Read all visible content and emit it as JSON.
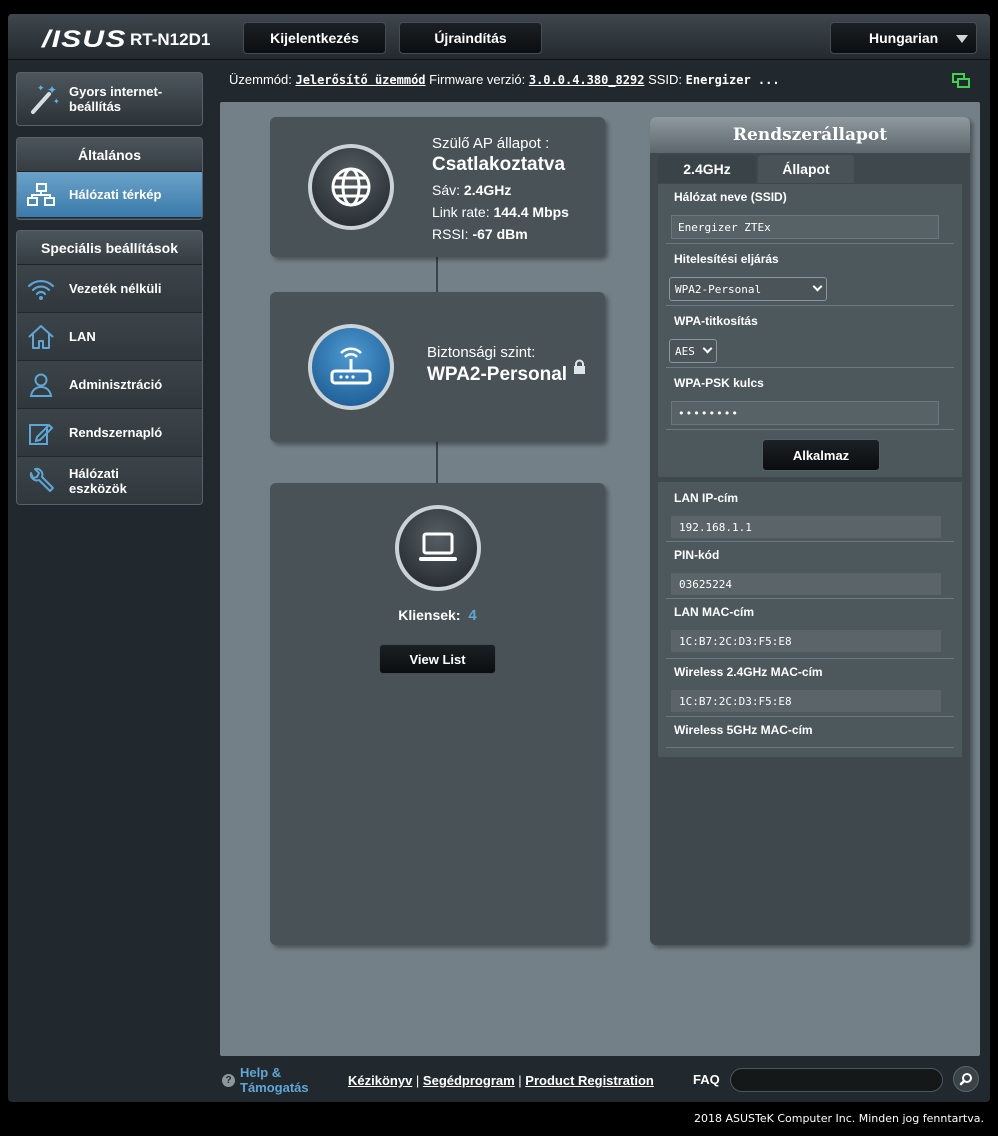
{
  "header": {
    "brand": "/ISUS",
    "model": "RT-N12D1",
    "logout": "Kijelentkezés",
    "reboot": "Újraindítás",
    "language": "Hungarian"
  },
  "sidebar": {
    "quick_setup": "Gyors internet-beállítás",
    "general_head": "Általános",
    "network_map": "Hálózati térkép",
    "advanced_head": "Speciális beállítások",
    "items": [
      {
        "label": "Vezeték nélküli"
      },
      {
        "label": "LAN"
      },
      {
        "label": "Adminisztráció"
      },
      {
        "label": "Rendszernapló"
      },
      {
        "label": "Hálózati eszközök"
      }
    ]
  },
  "status": {
    "mode_label": "Üzemmód:",
    "mode_value": "Jelerősítő üzemmód",
    "fw_label": "Firmware verzió:",
    "fw_value": "3.0.0.4.380_8292",
    "ssid_label": "SSID:",
    "ssid_value": "Energizer ..."
  },
  "ap_card": {
    "title": "Szülő AP állapot :",
    "state": "Csatlakoztatva",
    "band_label": "Sáv:",
    "band_value": "2.4GHz",
    "link_label": "Link rate:",
    "link_value": "144.4 Mbps",
    "rssi_label": "RSSI:",
    "rssi_value": "-67 dBm"
  },
  "security_card": {
    "label": "Biztonsági szint:",
    "value": "WPA2-Personal"
  },
  "clients_card": {
    "label": "Kliensek:",
    "count": "4",
    "button": "View List"
  },
  "system_status": {
    "title": "Rendszerállapot",
    "tabs": [
      "2.4GHz",
      "Állapot"
    ],
    "ssid_label": "Hálózat neve (SSID)",
    "ssid_value": "Energizer ZTEx",
    "auth_label": "Hitelesítési eljárás",
    "auth_value": "WPA2-Personal",
    "enc_label": "WPA-titkosítás",
    "enc_value": "AES",
    "psk_label": "WPA-PSK kulcs",
    "psk_value": "••••••••",
    "apply": "Alkalmaz",
    "lan_ip_label": "LAN IP-cím",
    "lan_ip_value": "192.168.1.1",
    "pin_label": "PIN-kód",
    "pin_value": "03625224",
    "lan_mac_label": "LAN MAC-cím",
    "lan_mac_value": "1C:B7:2C:D3:F5:E8",
    "w24_mac_label": "Wireless 2.4GHz MAC-cím",
    "w24_mac_value": "1C:B7:2C:D3:F5:E8",
    "w5_mac_label": "Wireless 5GHz MAC-cím"
  },
  "footer": {
    "help": "Help & Támogatás",
    "manual": "Kézikönyv",
    "utility": "Segédprogram",
    "registration": "Product Registration",
    "faq": "FAQ",
    "copyright": "2018 ASUSTeK Computer Inc. Minden jog fenntartva."
  },
  "colors": {
    "accent_blue": "#5ea6d6",
    "active_menu": "#3a7bab",
    "link_icon_green": "#3fd24a"
  }
}
